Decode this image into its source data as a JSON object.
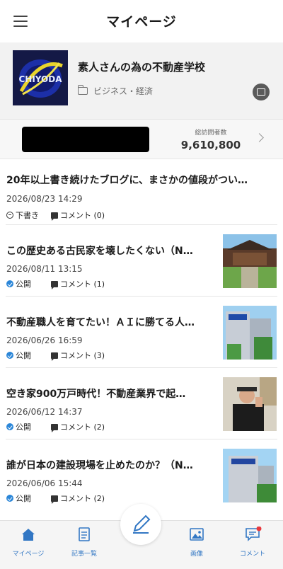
{
  "header": {
    "title": "マイページ",
    "menu_icon": "hamburger-menu-icon"
  },
  "profile": {
    "blog_name": "素人さんの為の不動産学校",
    "category": "ビジネス・経済",
    "logo_text": "CHIYODA",
    "share_icon": "share-icon"
  },
  "stats": {
    "label": "総訪問者数",
    "value": "9,610,800"
  },
  "posts": [
    {
      "title": "20年以上書き続けたブログに、まさかの値段がつい…",
      "date": "2026/08/23 14:29",
      "status": "下書き",
      "comments": "コメント (0)",
      "status_icon": "draft-icon",
      "has_thumb": false
    },
    {
      "title": "この歴史ある古民家を壊したくない（N…",
      "date": "2026/08/11 13:15",
      "status": "公開",
      "comments": "コメント (1)",
      "status_icon": "check-icon",
      "has_thumb": true
    },
    {
      "title": "不動産職人を育てたい！ＡＩに勝てる人…",
      "date": "2026/06/26 16:59",
      "status": "公開",
      "comments": "コメント (3)",
      "status_icon": "check-icon",
      "has_thumb": true
    },
    {
      "title": "空き家900万戸時代！不動産業界で起…",
      "date": "2026/06/12 14:37",
      "status": "公開",
      "comments": "コメント (2)",
      "status_icon": "check-icon",
      "has_thumb": true
    },
    {
      "title": "誰が日本の建設現場を止めたのか？（N…",
      "date": "2026/06/06 15:44",
      "status": "公開",
      "comments": "コメント (2)",
      "status_icon": "check-icon",
      "has_thumb": true
    }
  ],
  "nav": {
    "mypage": "マイページ",
    "articles": "記事一覧",
    "images": "画像",
    "comments": "コメント"
  },
  "colors": {
    "accent": "#3277c4",
    "public": "#2b86d8",
    "badge": "#e8383d"
  }
}
